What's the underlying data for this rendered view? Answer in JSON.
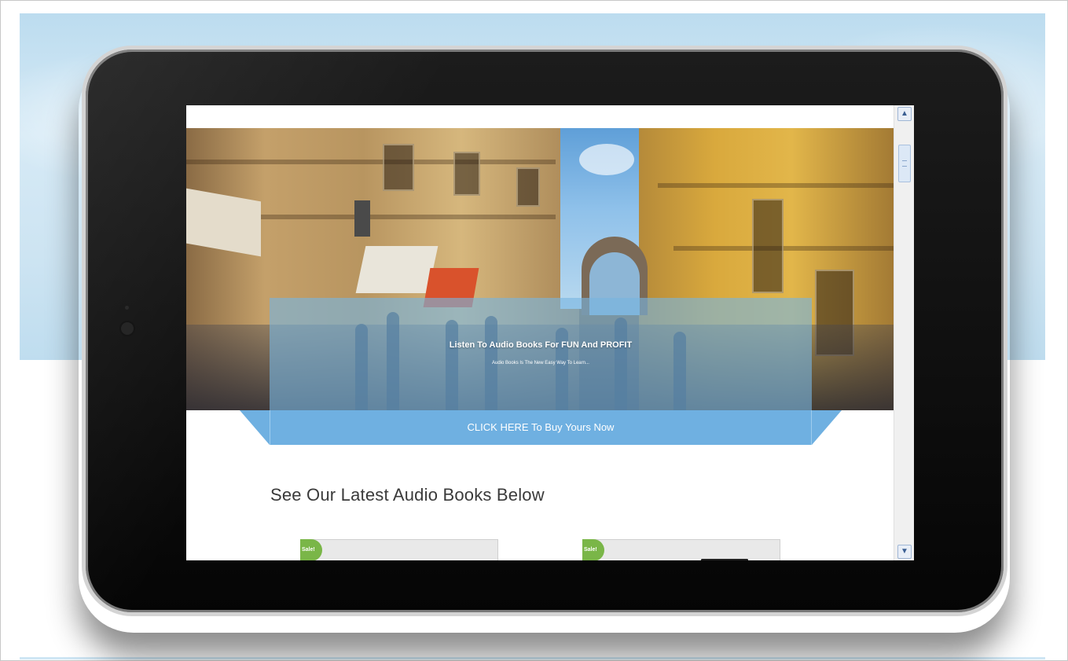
{
  "hero": {
    "title": "Listen To Audio Books For FUN And PROFIT",
    "subtitle": "Audio Books Is The New Easy Way To Learn..."
  },
  "cta": {
    "label": "CLICK HERE To Buy Yours Now"
  },
  "section": {
    "title": "See Our Latest Audio Books Below"
  },
  "products": [
    {
      "badge": "Sale!"
    },
    {
      "badge": "Sale!"
    }
  ],
  "scrollbar": {
    "up_icon": "chevron-up-icon",
    "down_icon": "chevron-down-icon"
  },
  "colors": {
    "cta": "#6fb0e1",
    "sale_badge": "#7ab648",
    "overlay": "#78b4e1"
  }
}
